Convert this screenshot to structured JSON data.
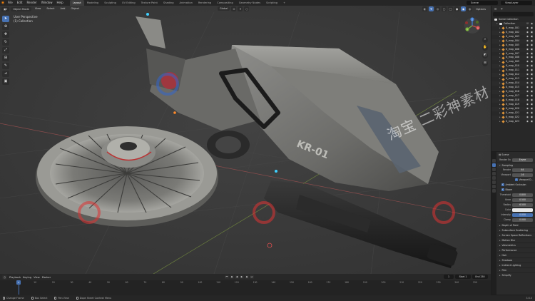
{
  "app": {
    "menus": [
      "File",
      "Edit",
      "Render",
      "Window",
      "Help"
    ],
    "workspaces": [
      "Layout",
      "Modeling",
      "Sculpting",
      "UV Editing",
      "Texture Paint",
      "Shading",
      "Animation",
      "Rendering",
      "Compositing",
      "Geometry Nodes",
      "Scripting"
    ],
    "active_workspace": "Layout",
    "scene": "Scene",
    "view_layer": "ViewLayer"
  },
  "viewport": {
    "header": {
      "mode": "Object Mode",
      "menus": [
        "View",
        "Select",
        "Add",
        "Object"
      ],
      "orientation": "Global"
    },
    "info_line1": "User Perspective",
    "info_line2": "(1) Collection",
    "options_label": "Options",
    "gizmo_axes": {
      "x": "X",
      "y": "Y",
      "z": "Z"
    },
    "watermark": "淘宝 二彩神素材",
    "model_label": "KR-01",
    "tools": [
      "select-tool",
      "cursor-tool",
      "move-tool",
      "rotate-tool",
      "scale-tool",
      "transform-tool",
      "annotate-tool",
      "measure-tool",
      "add-cube-tool"
    ]
  },
  "outliner": {
    "search_placeholder": "",
    "root": "Scene Collection",
    "collection": "Collection",
    "items": [
      "K_map_001",
      "K_map_002",
      "K_map_003",
      "K_map_004",
      "K_map_005",
      "K_map_006",
      "K_map_007",
      "K_map_008",
      "K_map_009",
      "K_map_010",
      "K_map_011",
      "K_map_012",
      "K_map_013",
      "K_map_014",
      "K_map_015",
      "K_map_016",
      "K_map_017",
      "K_map_018",
      "K_map_019",
      "K_map_020",
      "K_map_021",
      "K_map_022",
      "K_map_023"
    ]
  },
  "properties": {
    "scene_name": "Scene",
    "render_engine_label": "Render En",
    "render_engine": "Eevee",
    "sampling_header": "Sampling",
    "render_label": "Render",
    "render_value": "64",
    "viewport_label": "Viewport",
    "viewport_value": "16",
    "viewport_denoise": "Viewport D...",
    "ao_label": "Ambient Occlusion",
    "bloom_label": "Bloom",
    "threshold_label": "Threshold",
    "threshold_value": "0.800",
    "knee_label": "Knee",
    "knee_value": "0.500",
    "radius_label": "Radius",
    "radius_value": "6.500",
    "color_label": "Color",
    "intensity_label": "Intensity",
    "intensity_value": "0.050",
    "clamp_label": "Clamp",
    "clamp_value": "0.000",
    "panels": [
      "Depth of Field",
      "Subsurface Scattering",
      "Screen Space Reflections",
      "Motion Blur",
      "Volumetrics",
      "Performance",
      "Hair",
      "Shadows",
      "Indirect Lighting",
      "Film",
      "Simplify"
    ]
  },
  "timeline": {
    "menus": [
      "Playback",
      "Keying",
      "View",
      "Marker"
    ],
    "current_frame": "1",
    "start_label": "Start",
    "start": "1",
    "end_label": "End",
    "end": "250",
    "ruler_ticks": [
      "1",
      "10",
      "20",
      "30",
      "40",
      "50",
      "60",
      "70",
      "80",
      "90",
      "100",
      "110",
      "120",
      "130",
      "140",
      "150",
      "160",
      "170",
      "180",
      "190",
      "200",
      "210",
      "220",
      "230",
      "240",
      "250"
    ]
  },
  "statusbar": {
    "select": "Change Frame",
    "box": "Box Select",
    "pan": "Pan View",
    "context": "Dope Sheet Context Menu",
    "version": "3.6.0"
  }
}
